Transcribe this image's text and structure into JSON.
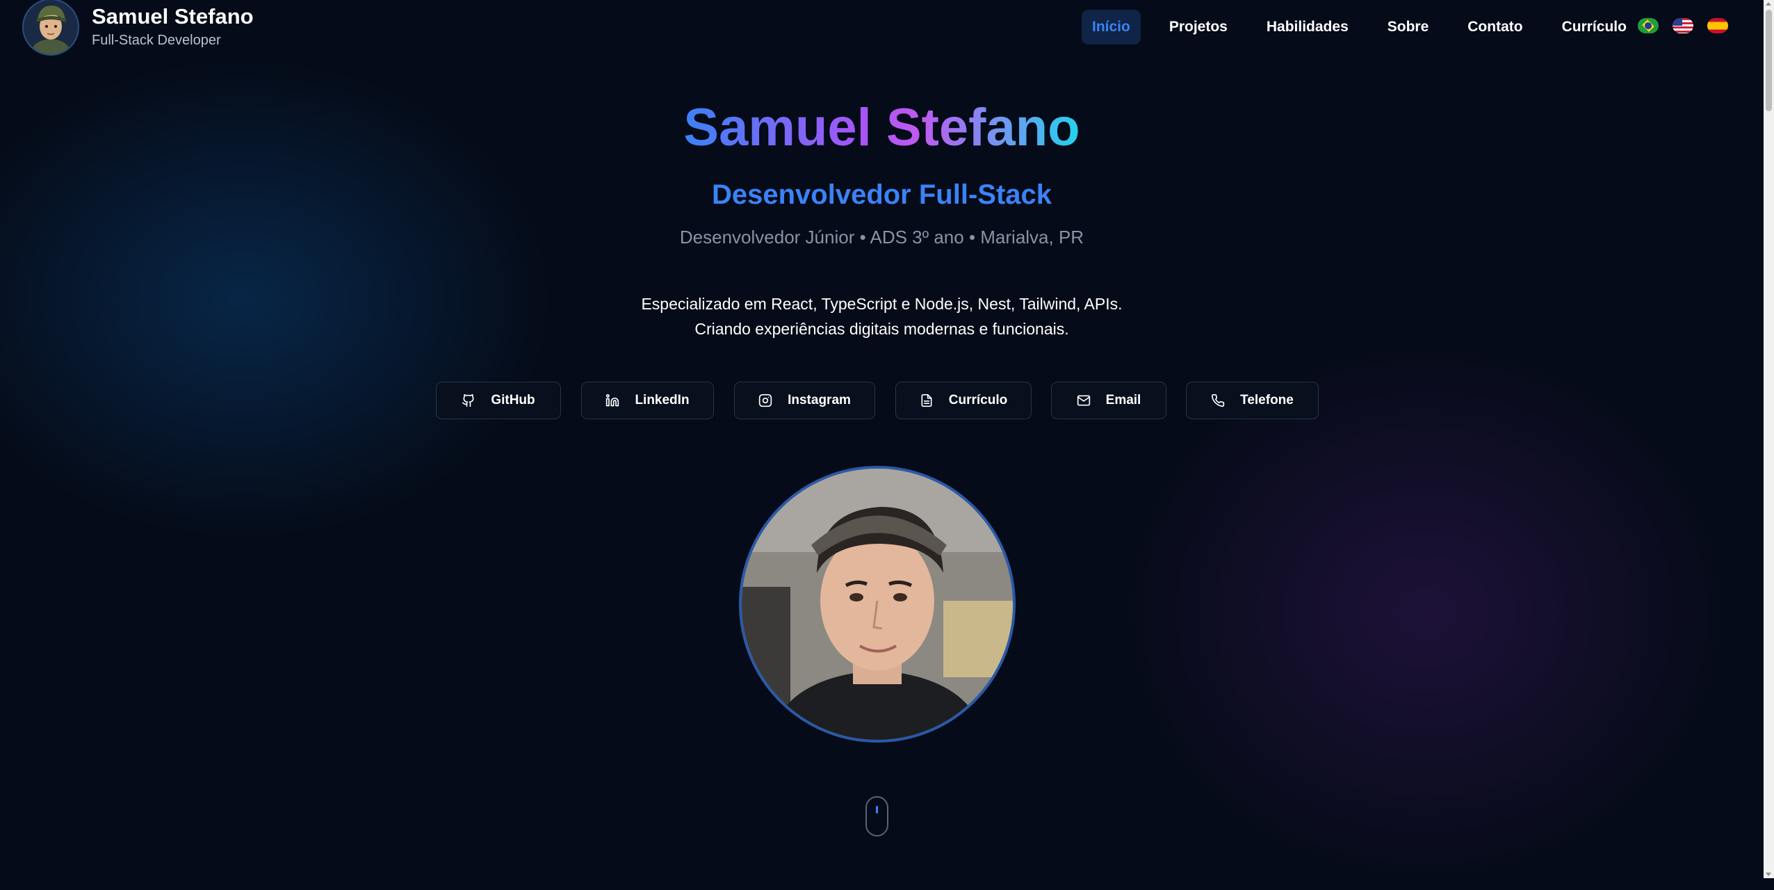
{
  "header": {
    "name": "Samuel Stefano",
    "role": "Full-Stack Developer",
    "nav": [
      "Início",
      "Projetos",
      "Habilidades",
      "Sobre",
      "Contato",
      "Currículo"
    ],
    "active_nav": "Início",
    "languages": [
      {
        "code": "pt-BR",
        "icon": "brazil-flag-icon"
      },
      {
        "code": "en-US",
        "icon": "usa-flag-icon"
      },
      {
        "code": "es",
        "icon": "spain-flag-icon"
      }
    ]
  },
  "hero": {
    "title": "Samuel Stefano",
    "role": "Desenvolvedor Full-Stack",
    "meta": "Desenvolvedor Júnior • ADS 3º ano • Marialva, PR",
    "desc_line1": "Especializado em React, TypeScript e Node.js, Nest, Tailwind, APIs.",
    "desc_line2": "Criando experiências digitais modernas e funcionais."
  },
  "social": [
    {
      "label": "GitHub",
      "icon": "github-icon"
    },
    {
      "label": "LinkedIn",
      "icon": "linkedin-icon"
    },
    {
      "label": "Instagram",
      "icon": "instagram-icon"
    },
    {
      "label": "Currículo",
      "icon": "file-icon"
    },
    {
      "label": "Email",
      "icon": "mail-icon"
    },
    {
      "label": "Telefone",
      "icon": "phone-icon"
    }
  ],
  "colors": {
    "background": "#050b18",
    "accent": "#3b82f6",
    "gradient_purple": "#a855f7",
    "gradient_cyan": "#22d3ee"
  }
}
